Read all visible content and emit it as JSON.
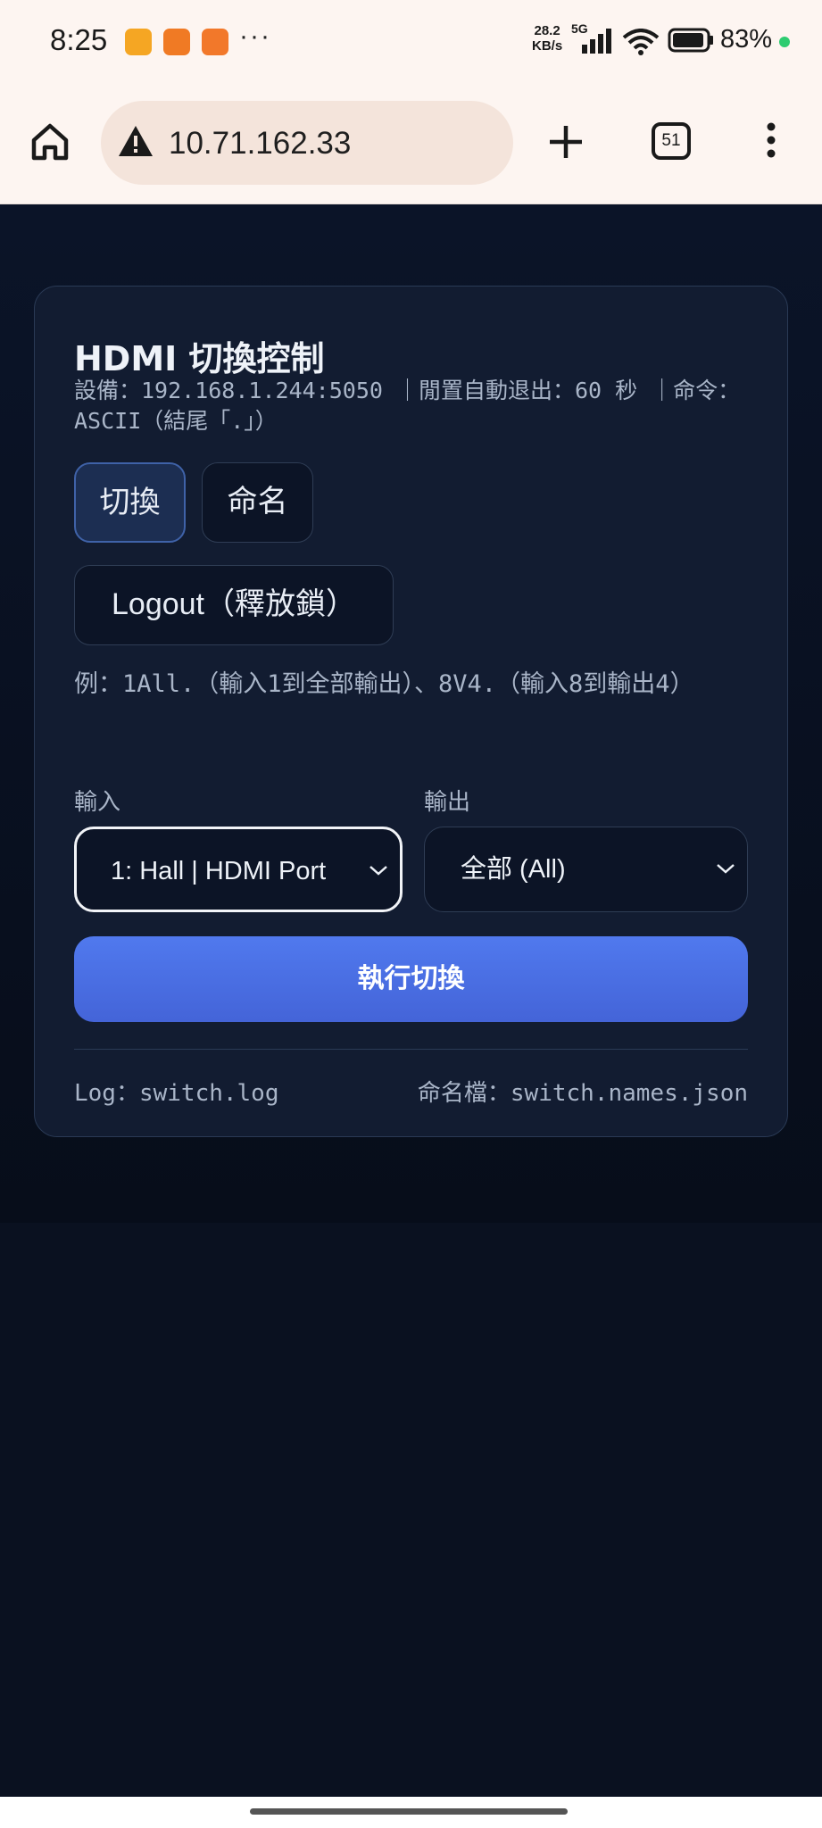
{
  "status_bar": {
    "time": "8:25",
    "app_icons": [
      "app-icon-1",
      "app-icon-2",
      "app-icon-3"
    ],
    "more": "···",
    "net_speed_value": "28.2",
    "net_speed_unit": "KB/s",
    "network_type": "5G",
    "battery_percent": "83%"
  },
  "browser": {
    "url": "10.71.162.33",
    "tab_count": "51",
    "colors": {
      "bar": "#fdf5f1",
      "url_pill": "#f4e4db"
    }
  },
  "card": {
    "title": "HDMI 切換控制",
    "subtitle": "設備：192.168.1.244:5050 ｜閒置自動退出：60 秒 ｜命令：ASCII（結尾「.」）",
    "mode_buttons": [
      {
        "label": "切換",
        "active": true
      },
      {
        "label": "命名",
        "active": false
      }
    ],
    "logout_label": "Logout（釋放鎖）",
    "example": "例：1All.（輸入1到全部輸出）、8V4.（輸入8到輸出4）",
    "input_label": "輸入",
    "output_label": "輸出",
    "input_value": "1: Hall | HDMI Port",
    "output_value": "全部 (All)",
    "run_label": "執行切換",
    "footer_log": "Log：switch.log",
    "footer_names": "命名檔：switch.names.json"
  },
  "colors": {
    "page_bg": "#0b1428",
    "card_bg": "#121c31",
    "accent": "#4a6ce6",
    "text": "#eef2f8",
    "muted": "#a9b5c8"
  }
}
